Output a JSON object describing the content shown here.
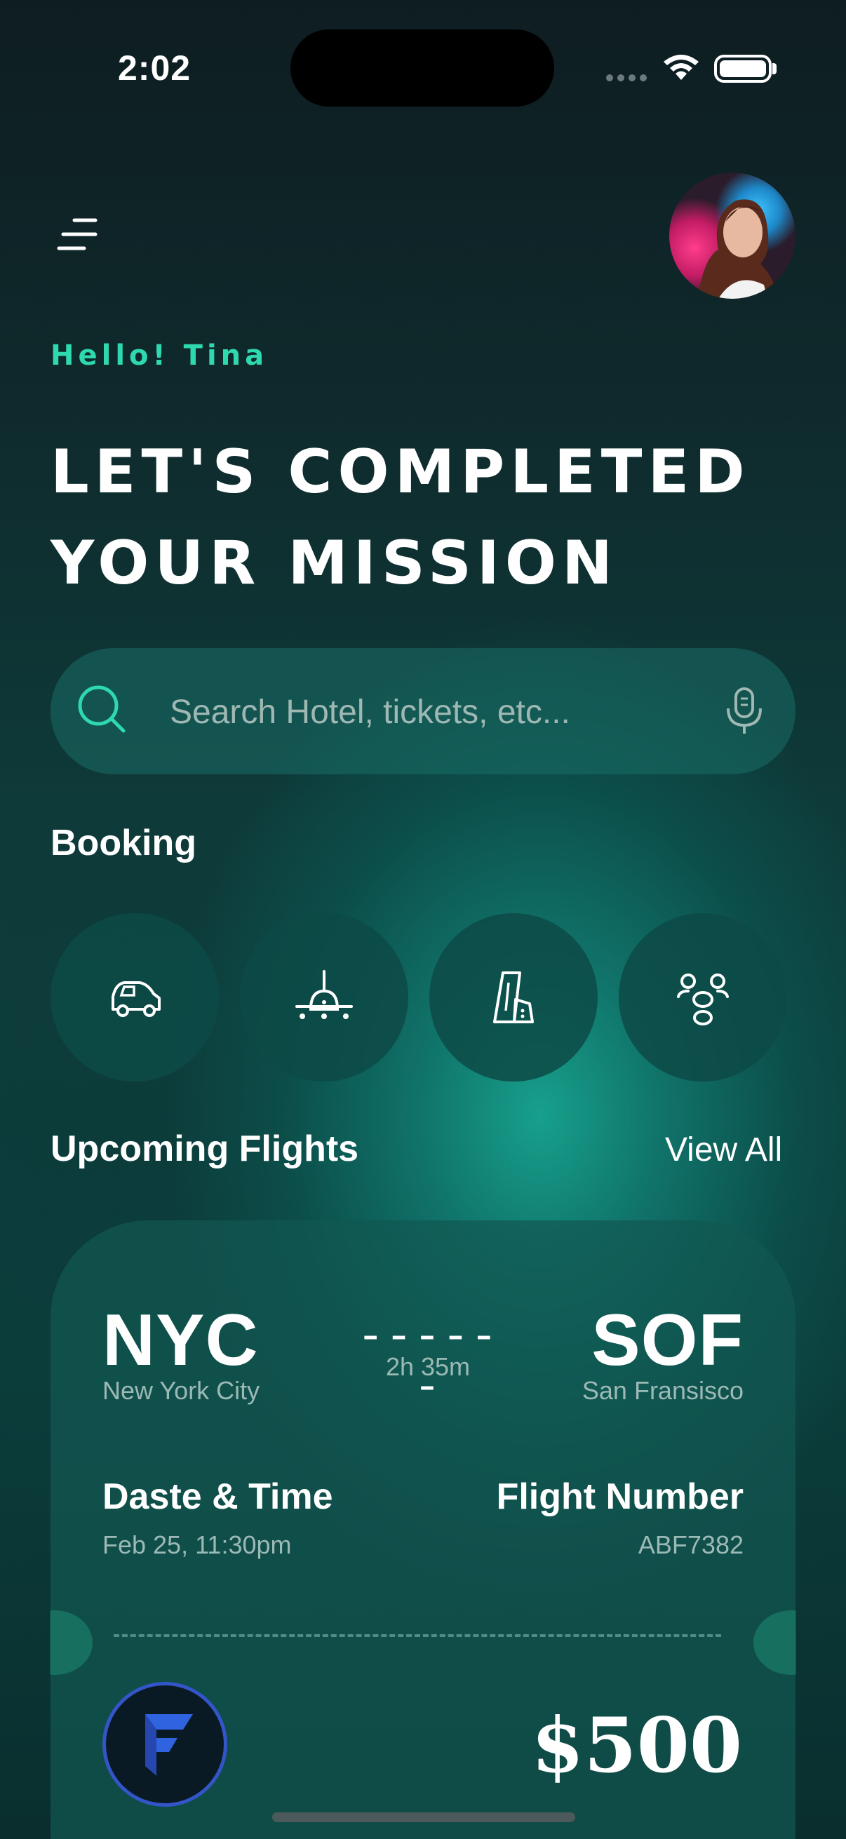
{
  "status_bar": {
    "time": "2:02"
  },
  "header": {
    "greeting": "Hello! Tina",
    "headline_line1": "LET'S COMPLETED",
    "headline_line2": "YOUR MISSION"
  },
  "search": {
    "placeholder": "Search Hotel, tickets, etc..."
  },
  "booking": {
    "title": "Booking",
    "items": [
      {
        "icon": "car-icon"
      },
      {
        "icon": "plane-icon"
      },
      {
        "icon": "hotel-icon"
      },
      {
        "icon": "group-icon"
      }
    ]
  },
  "upcoming": {
    "title": "Upcoming Flights",
    "view_all": "View All",
    "flight": {
      "from_code": "NYC",
      "from_city": "New York City",
      "route_line": "------",
      "duration": "2h 35m",
      "to_code": "SOF",
      "to_city": "San Fransisco",
      "date_label": "Daste & Time",
      "date_value": "Feb 25, 11:30pm",
      "flight_number_label": "Flight Number",
      "flight_number_value": "ABF7382",
      "price": "$500"
    }
  },
  "colors": {
    "accent": "#2fd9b0",
    "logo_blue": "#3355c8"
  }
}
